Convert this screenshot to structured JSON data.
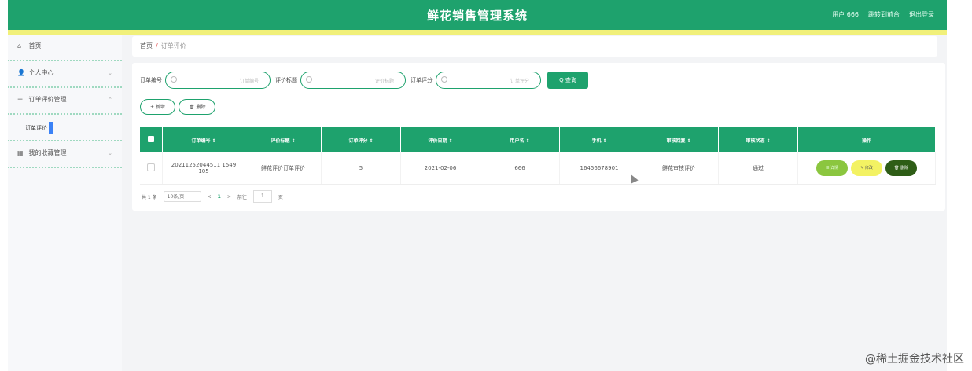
{
  "header": {
    "title": "鲜花销售管理系统",
    "user_label": "用户 666",
    "front_link": "跳转到前台",
    "logout_link": "退出登录"
  },
  "sidebar": {
    "items": [
      {
        "label": "首页",
        "icon": "home-icon"
      },
      {
        "label": "个人中心",
        "icon": "user-icon"
      },
      {
        "label": "订单评价管理",
        "icon": "list-icon"
      },
      {
        "label": "我的收藏管理",
        "icon": "grid-icon"
      }
    ],
    "sub_item_label": "订单评价"
  },
  "breadcrumb": {
    "home": "首页",
    "separator": "/",
    "current": "订单评价"
  },
  "search": {
    "fields": [
      {
        "label": "订单编号",
        "placeholder": "订单编号"
      },
      {
        "label": "评价标题",
        "placeholder": "评价标题"
      },
      {
        "label": "订单评分",
        "placeholder": "订单评分"
      }
    ],
    "button_label": "Q 查询"
  },
  "actions": {
    "add_label": "+ 新增",
    "delete_label": "🗑 删除"
  },
  "table": {
    "columns": [
      "订单编号 ⇕",
      "评价标题 ⇕",
      "订单评分 ⇕",
      "评价日期 ⇕",
      "用户名 ⇕",
      "手机 ⇕",
      "审核回复 ⇕",
      "审核状态 ⇕",
      "操作"
    ],
    "rows": [
      {
        "order_no": "20211252044511 1549 105",
        "title": "鲜花评价订单评价",
        "score": "5",
        "date": "2021-02-06",
        "username": "666",
        "phone": "16456678901",
        "reply": "鲜花审核评价",
        "status": "通过"
      }
    ],
    "op_labels": {
      "detail": "☰ 详情",
      "edit": "✎ 修改",
      "delete": "🗑 删除"
    }
  },
  "pager": {
    "total": "共 1 条",
    "page_size": "10条/页",
    "prev": "<",
    "current": "1",
    "next": ">",
    "goto_label": "前往",
    "goto_value": "1",
    "page_suffix": "页"
  },
  "watermark": "@稀土掘金技术社区",
  "colors": {
    "primary": "#1ea26d",
    "accent_yellow": "#f1f07a"
  }
}
